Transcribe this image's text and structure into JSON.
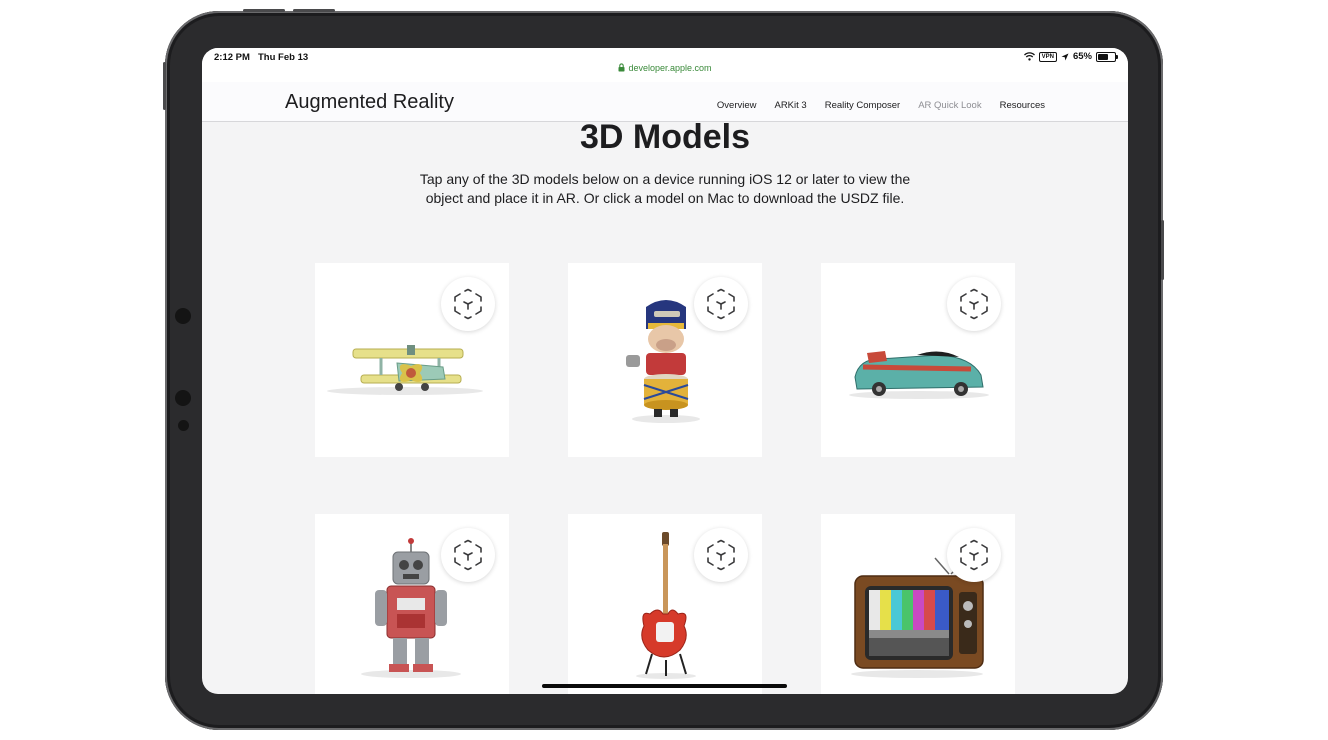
{
  "status": {
    "time": "2:12 PM",
    "date": "Thu Feb 13",
    "url": "developer.apple.com",
    "vpn": "VPN",
    "battery": "65%",
    "battery_level": 0.65
  },
  "nav": {
    "brand": "Augmented Reality",
    "links": [
      "Overview",
      "ARKit 3",
      "Reality Composer",
      "AR Quick Look",
      "Resources"
    ],
    "current": "AR Quick Look"
  },
  "page": {
    "title": "3D Models",
    "description": "Tap any of the 3D models below on a device running iOS 12 or later to view the object and place it in AR. Or click a model on Mac to download the USDZ file."
  },
  "models": [
    {
      "icon": "toy-biplane"
    },
    {
      "icon": "toy-drummer"
    },
    {
      "icon": "toy-rocket-car"
    },
    {
      "icon": "toy-robot"
    },
    {
      "icon": "electric-guitar"
    },
    {
      "icon": "retro-tv"
    }
  ],
  "colors": {
    "accent_lock": "#3a8a3a",
    "text": "#1d1d1f",
    "nav_current": "#8e8e93"
  }
}
